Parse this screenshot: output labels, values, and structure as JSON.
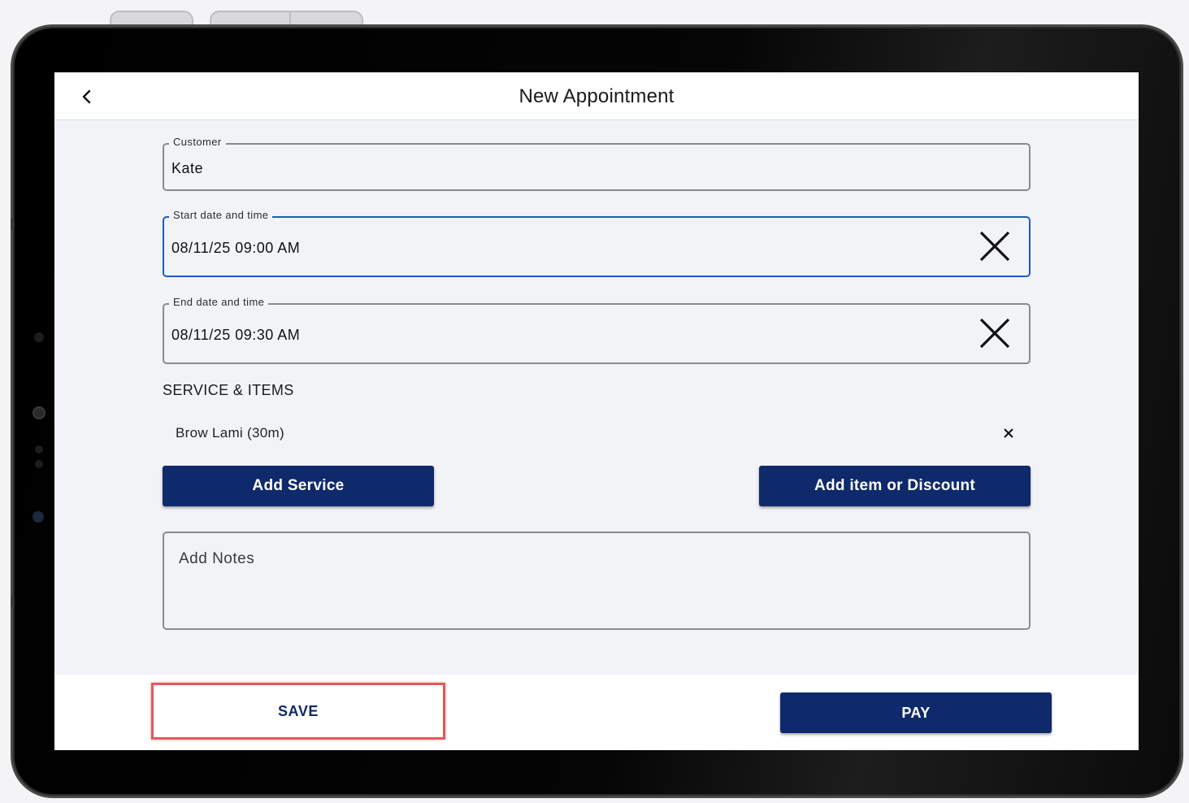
{
  "app": {
    "title": "New Appointment"
  },
  "form": {
    "customer": {
      "label": "Customer",
      "value": "Kate"
    },
    "start": {
      "label": "Start date and time",
      "value": "08/11/25 09:00 AM"
    },
    "end": {
      "label": "End date and time",
      "value": "08/11/25 09:30 AM"
    }
  },
  "services": {
    "heading": "SERVICE & ITEMS",
    "items": [
      {
        "name": "Brow Lami (30m)"
      }
    ],
    "add_service_label": "Add Service",
    "add_item_label": "Add item or Discount"
  },
  "notes": {
    "placeholder": "Add Notes"
  },
  "footer": {
    "save_label": "SAVE",
    "pay_label": "PAY"
  },
  "colors": {
    "primary": "#0f2a6b",
    "focus": "#1e5bbf",
    "highlight": "#e4595c"
  },
  "icons": {
    "back": "chevron-left-icon",
    "clear": "close-icon",
    "remove": "close-icon"
  }
}
